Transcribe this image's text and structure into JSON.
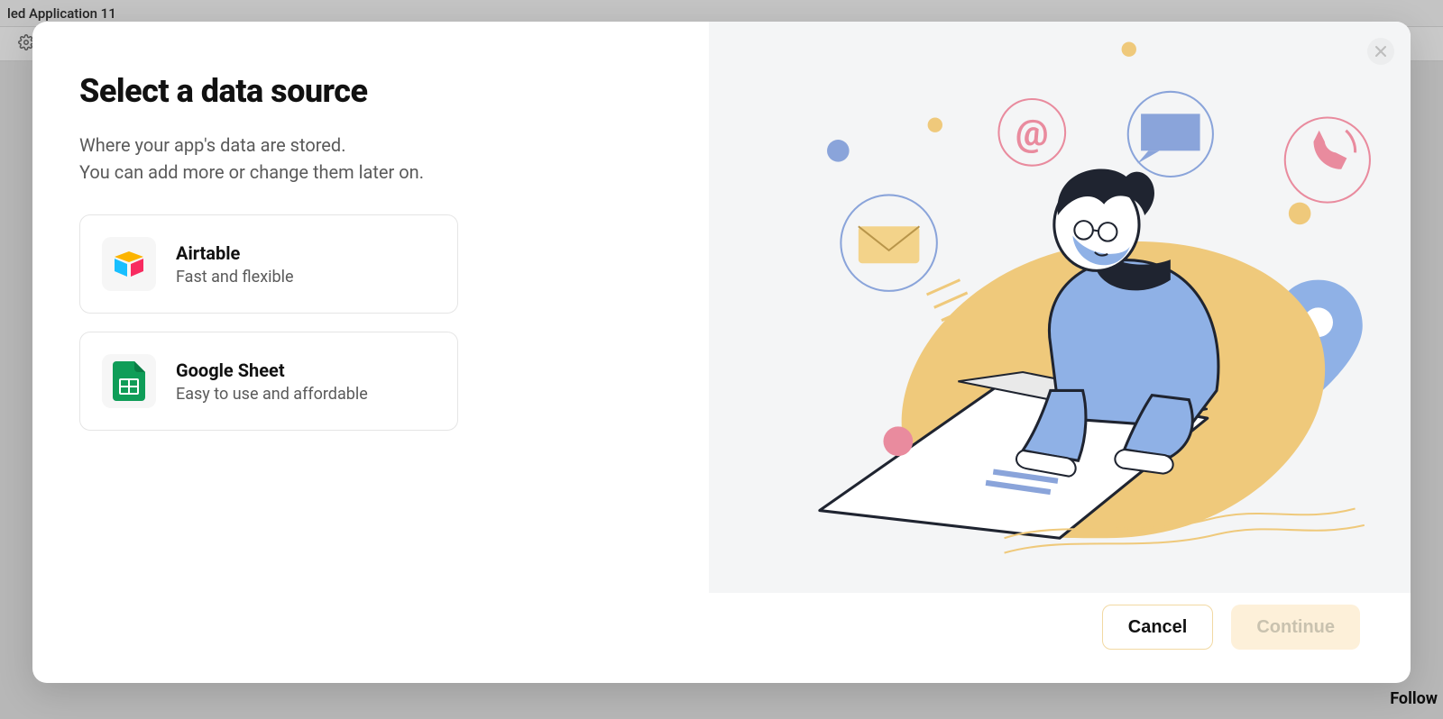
{
  "background": {
    "app_title": "led Application 11",
    "follow_label": "Follow"
  },
  "modal": {
    "title": "Select a data source",
    "subtitle_line1": "Where your app's data are stored.",
    "subtitle_line2": "You can add more or change them later on.",
    "options": [
      {
        "title": "Airtable",
        "desc": "Fast and flexible",
        "icon": "airtable"
      },
      {
        "title": "Google Sheet",
        "desc": "Easy to use and affordable",
        "icon": "google-sheets"
      }
    ],
    "footer": {
      "cancel": "Cancel",
      "continue": "Continue"
    }
  }
}
